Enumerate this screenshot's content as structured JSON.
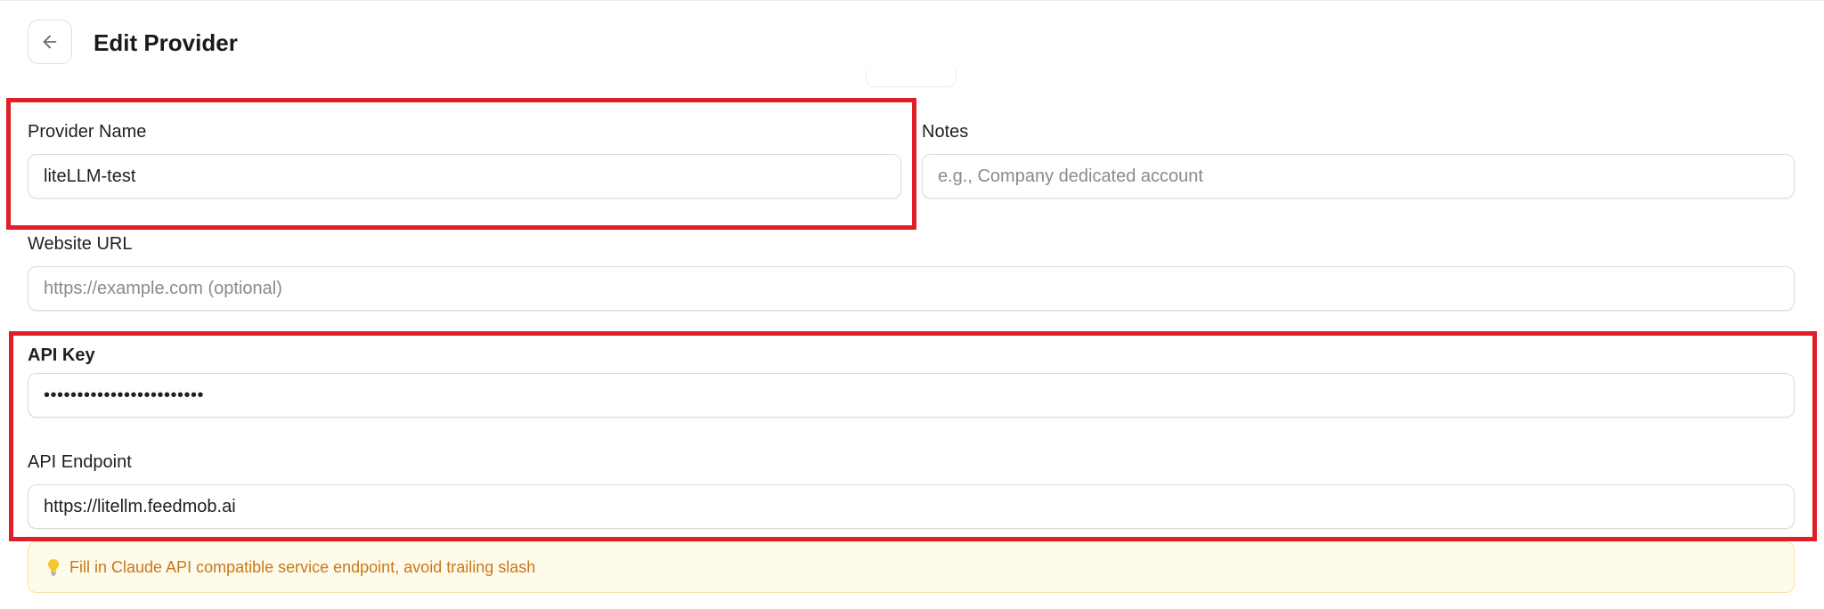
{
  "header": {
    "title": "Edit Provider",
    "back_icon": "arrow-left-icon"
  },
  "form": {
    "provider_name": {
      "label": "Provider Name",
      "value": "liteLLM-test"
    },
    "notes": {
      "label": "Notes",
      "placeholder": "e.g., Company dedicated account"
    },
    "website_url": {
      "label": "Website URL",
      "placeholder": "https://example.com (optional)"
    },
    "api_key": {
      "label": "API Key",
      "masked_value": "••••••••••••••••••••••••"
    },
    "api_endpoint": {
      "label": "API Endpoint",
      "value": "https://litellm.feedmob.ai"
    },
    "hint": {
      "icon": "lightbulb-icon",
      "text": "Fill in Claude API compatible service endpoint, avoid trailing slash"
    }
  },
  "colors": {
    "highlight": "#e01e26",
    "hint_background": "#fffbea",
    "hint_text": "#c8781a"
  }
}
